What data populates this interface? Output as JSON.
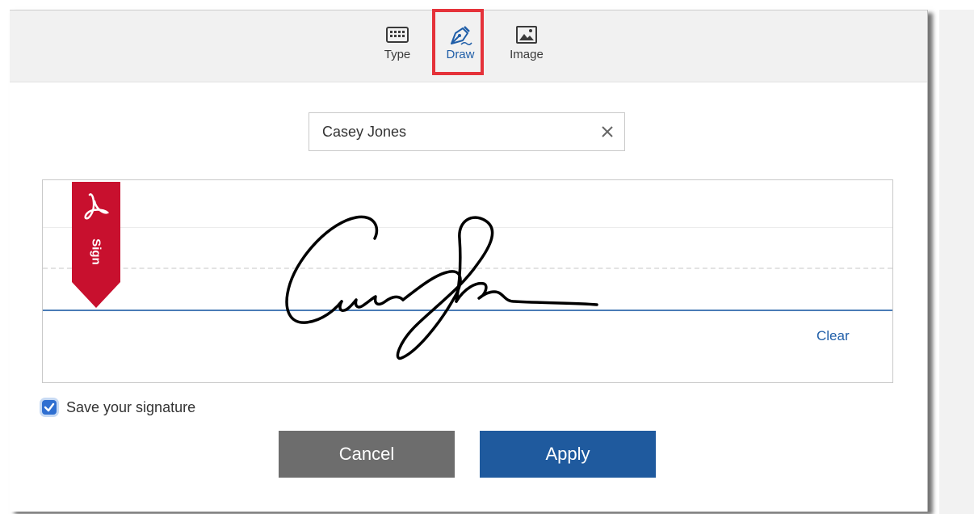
{
  "mode_tabs": {
    "type_label": "Type",
    "draw_label": "Draw",
    "image_label": "Image",
    "active": "Draw"
  },
  "name_field": {
    "value": "Casey Jones",
    "clear_icon": "close-icon"
  },
  "signature_area": {
    "flag_label": "Sign",
    "flag_icon": "acrobat-logo-icon",
    "clear_label": "Clear"
  },
  "save_signature": {
    "label": "Save your signature",
    "checked": true
  },
  "buttons": {
    "cancel_label": "Cancel",
    "apply_label": "Apply"
  },
  "colors": {
    "accent_blue": "#1f5a9e",
    "highlight_red": "#e5323a",
    "flag_red": "#c8102e",
    "cancel_gray": "#6d6d6d",
    "baseline_blue": "#4a7cb7"
  }
}
